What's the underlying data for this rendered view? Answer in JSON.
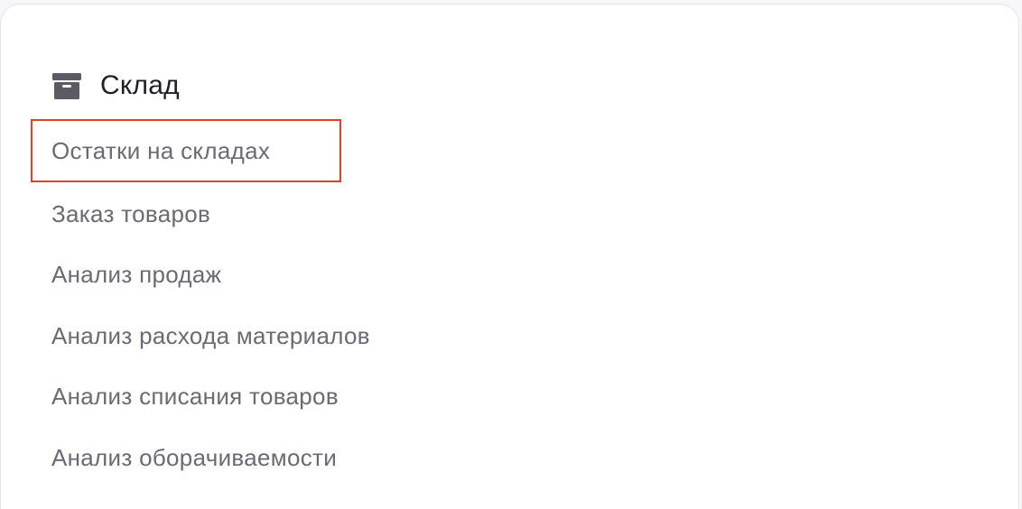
{
  "section": {
    "title": "Склад",
    "icon": "archive-box-icon"
  },
  "menu": {
    "items": [
      {
        "label": "Остатки на складах",
        "highlighted": true
      },
      {
        "label": "Заказ товаров"
      },
      {
        "label": "Анализ продаж"
      },
      {
        "label": "Анализ расхода материалов"
      },
      {
        "label": "Анализ списания товаров"
      },
      {
        "label": "Анализ оборачиваемости"
      }
    ]
  },
  "colors": {
    "highlight_border": "#d9452b",
    "item_text": "#6b6a72",
    "title_text": "#1f1f24",
    "icon": "#5c5b63"
  }
}
